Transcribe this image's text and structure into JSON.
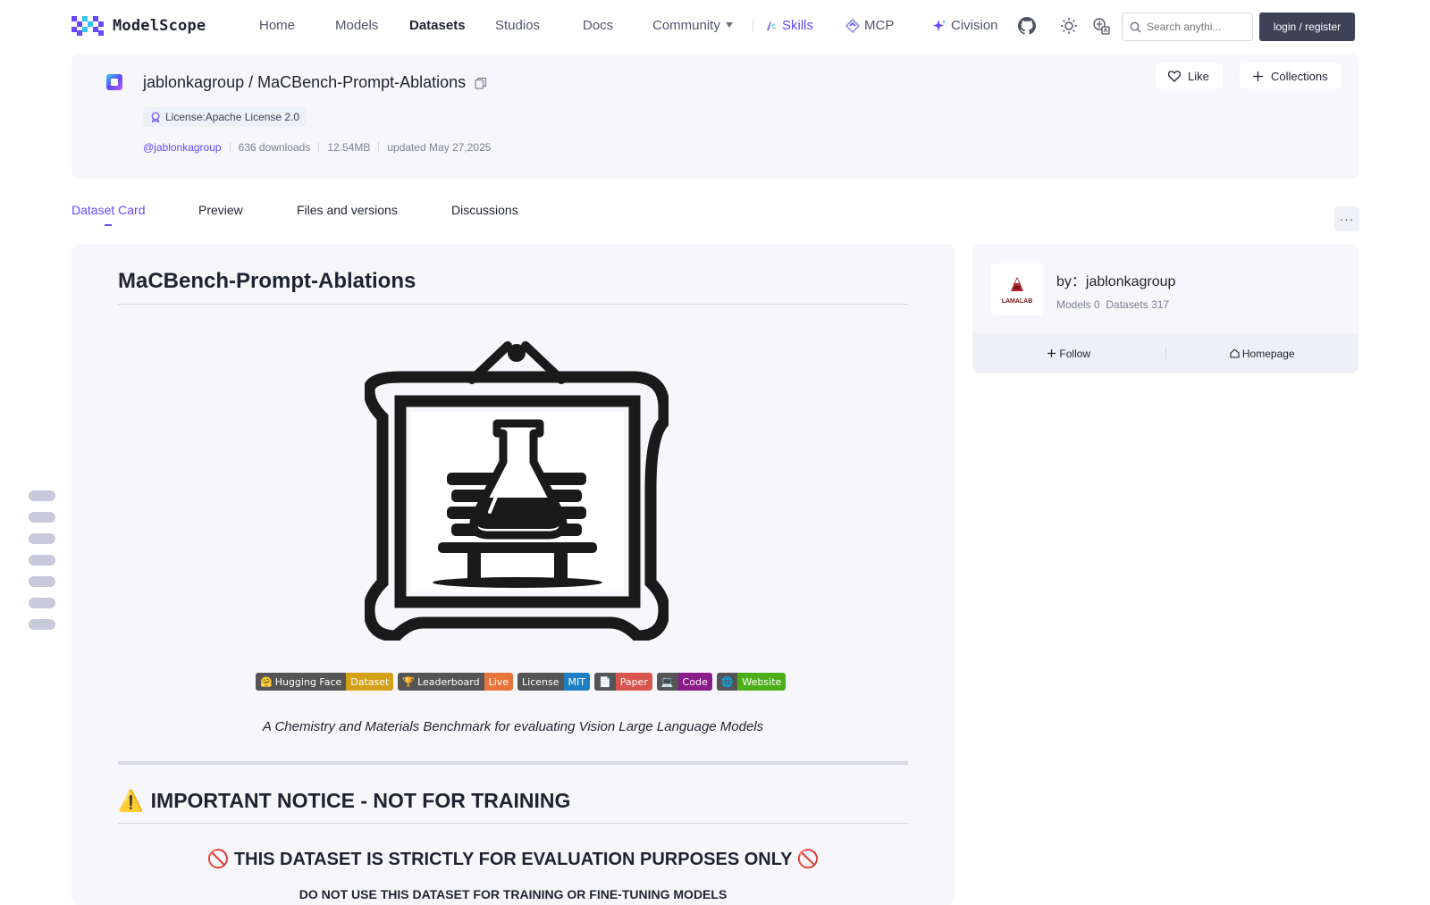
{
  "brand": {
    "name": "ModelScope",
    "accent": "#624aff"
  },
  "nav": {
    "home": "Home",
    "models": "Models",
    "datasets": "Datasets",
    "studios": "Studios",
    "docs": "Docs",
    "community": "Community",
    "skills": "Skills",
    "mcp": "MCP",
    "civision": "Civision",
    "search_placeholder": "Search anythi...",
    "login": "login / register"
  },
  "header": {
    "owner_path": "jablonkagroup / MaCBench-Prompt-Ablations",
    "license": "License:Apache License 2.0",
    "owner_handle": "@jablonkagroup",
    "downloads": "636 downloads",
    "size": "12.54MB",
    "updated": "updated May 27,2025",
    "like": "Like",
    "collections": "Collections"
  },
  "tabs": {
    "dataset_card": "Dataset Card",
    "preview": "Preview",
    "files": "Files and versions",
    "discussions": "Discussions",
    "more": "···"
  },
  "card": {
    "title": "MaCBench-Prompt-Ablations",
    "badges": [
      {
        "icon": "🤗",
        "left": "Hugging Face",
        "right": "Dataset",
        "color": "#d4a017"
      },
      {
        "icon": "🏆",
        "left": "Leaderboard",
        "right": "Live",
        "color": "#e8743b"
      },
      {
        "icon": "",
        "left": "License",
        "right": "MIT",
        "color": "#1f7ec1"
      },
      {
        "icon": "📄",
        "left": "",
        "right": "Paper",
        "color": "#d9534f"
      },
      {
        "icon": "💻",
        "left": "",
        "right": "Code",
        "color": "#8b1a8b"
      },
      {
        "icon": "🌐",
        "left": "",
        "right": "Website",
        "color": "#4caf1a"
      }
    ],
    "tagline": "A Chemistry and Materials Benchmark for evaluating Vision Large Language Models",
    "notice_icon": "⚠️",
    "notice": "IMPORTANT NOTICE - NOT FOR TRAINING",
    "strict_icon": "🚫",
    "strict": "THIS DATASET IS STRICTLY FOR EVALUATION PURPOSES ONLY",
    "donot": "DO NOT USE THIS DATASET FOR TRAINING OR FINE-TUNING MODELS"
  },
  "sidebar": {
    "avatar_text": "LAMALAB",
    "by": "by：jablonkagroup",
    "models": "Models 0",
    "datasets": "Datasets 317",
    "follow": "Follow",
    "homepage": "Homepage"
  }
}
